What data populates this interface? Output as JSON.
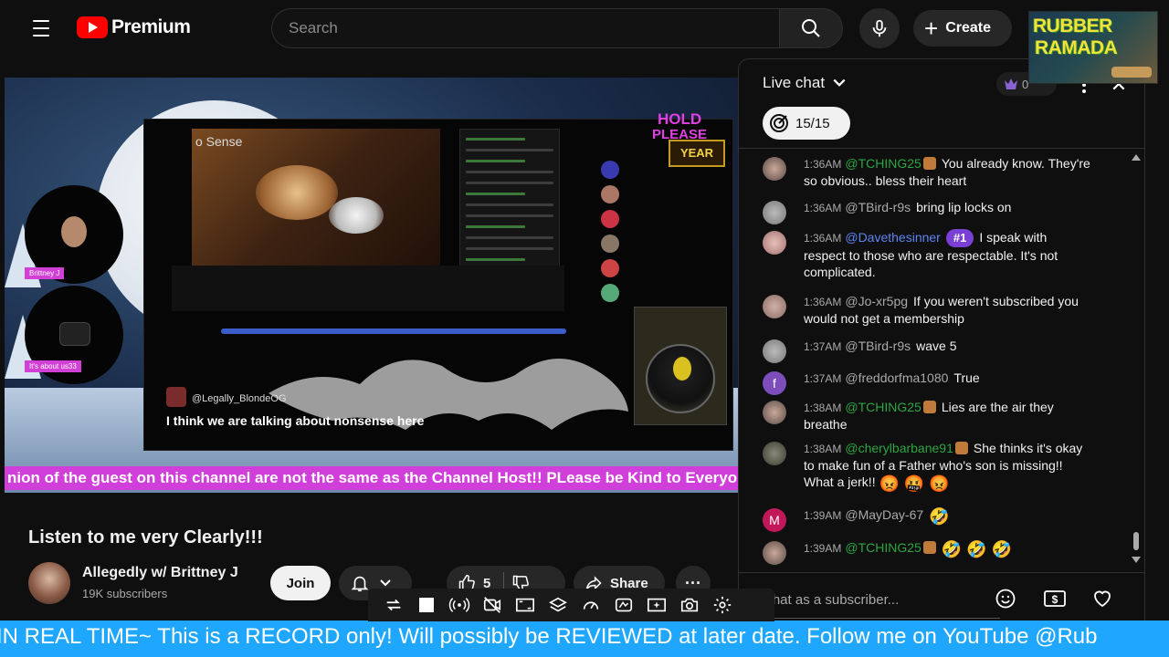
{
  "header": {
    "logo_text": "Premium",
    "search_placeholder": "Search",
    "create_label": "Create"
  },
  "overlay_logo": {
    "line1": "RUBBER",
    "line2": "RAMADA"
  },
  "video": {
    "inner_title": "o Sense",
    "hold_line1": "HOLD",
    "hold_line2": "PLEASE",
    "hold_badge": "YEAR",
    "comment_author": "@Legally_BlondeOG",
    "comment_text": "I think we are talking about nonsense here",
    "cam1_label": "Brittney J",
    "cam2_label": "It's about us33",
    "pink_ticker": "nion of the guest on this channel are not the same as the Channel Host!! PLease be Kind to Everyo"
  },
  "below": {
    "title": "Listen to me very Clearly!!!",
    "channel_name": "Allegedly w/ Brittney J",
    "subscribers": "19K subscribers",
    "join_label": "Join",
    "like_count": "5",
    "share_label": "Share"
  },
  "toolbar": {
    "icons": [
      "repeat-icon",
      "stop-icon",
      "broadcast-icon",
      "camera-off-icon",
      "screen-icon",
      "layers-icon",
      "speed-icon",
      "color-icon",
      "sparkle-icon",
      "snapshot-icon",
      "settings-icon"
    ]
  },
  "chat": {
    "title": "Live chat",
    "crown_count": "0",
    "poll_count": "15/15",
    "input_placeholder": "Chat as a subscriber...",
    "messages": [
      {
        "time": "1:36AM",
        "author": "@TCHING25",
        "type": "member",
        "text": "You already know. They're so obvious.. bless their heart"
      },
      {
        "time": "1:36AM",
        "author": "@TBird-r9s",
        "type": "normal",
        "text": "bring lip locks on"
      },
      {
        "time": "1:36AM",
        "author": "@Davethesinner",
        "type": "mod",
        "rank": "#1",
        "text": "I speak with respect to those who are respectable. It's not complicated."
      },
      {
        "time": "1:36AM",
        "author": "@Jo-xr5pg",
        "type": "normal",
        "text": "If you weren't subscribed you would not get a membership"
      },
      {
        "time": "1:37AM",
        "author": "@TBird-r9s",
        "type": "normal",
        "text": "wave 5"
      },
      {
        "time": "1:37AM",
        "author": "@freddorfma1080",
        "type": "normal",
        "text": "True",
        "avatar_letter": "f"
      },
      {
        "time": "1:38AM",
        "author": "@TCHING25",
        "type": "member",
        "text": "Lies are the air they breathe"
      },
      {
        "time": "1:38AM",
        "author": "@cherylbarbane91",
        "type": "member",
        "text": "She thinks it's okay to make fun of a Father who's son is missing!! What a jerk!!",
        "emojis": "😡 🤬 😡"
      },
      {
        "time": "1:39AM",
        "author": "@MayDay-67",
        "type": "normal",
        "text": "",
        "emojis": "🤣",
        "avatar_letter": "M"
      },
      {
        "time": "1:39AM",
        "author": "@TCHING25",
        "type": "member",
        "text": "",
        "emojis": "🤣 🤣 🤣"
      }
    ]
  },
  "bottom_ticker": "IN REAL TIME~ This is a RECORD only! Will possibly be REVIEWED at later date. Follow me on YouTube @Rub",
  "colors": {
    "brand_red": "#ff0000",
    "member_green": "#2ba640",
    "mod_blue": "#5e84f1",
    "ticker_pink": "#d13fda",
    "ticker_blue": "#1fa7ff"
  }
}
